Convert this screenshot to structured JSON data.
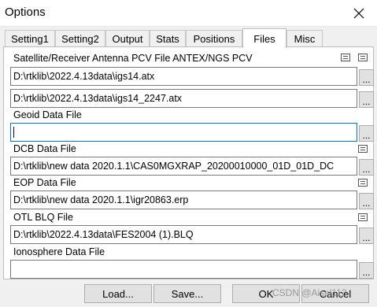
{
  "window": {
    "title": "Options"
  },
  "tabs": [
    "Setting1",
    "Setting2",
    "Output",
    "Stats",
    "Positions",
    "Files",
    "Misc"
  ],
  "active_tab": "Files",
  "files": {
    "antenna_label": "Satellite/Receiver Antenna PCV File ANTEX/NGS PCV",
    "antenna_sat": "D:\\rtklib\\2022.4.13data\\igs14.atx",
    "antenna_rcv": "D:\\rtklib\\2022.4.13data\\igs14_2247.atx",
    "geoid_label": "Geoid Data File",
    "geoid_value": "",
    "dcb_label": "DCB Data File",
    "dcb_value": "D:\\rtklib\\new data 2020.1.1\\CAS0MGXRAP_20200010000_01D_01D_DC",
    "eop_label": "EOP Data File",
    "eop_value": "D:\\rtklib\\new data 2020.1.1\\igr20863.erp",
    "otl_label": "OTL BLQ File",
    "otl_value": "D:\\rtklib\\2022.4.13data\\FES2004 (1).BLQ",
    "iono_label": "Ionosphere Data File",
    "iono_value": ""
  },
  "browse_label": "...",
  "buttons": {
    "load": "Load...",
    "save": "Save...",
    "ok": "OK",
    "cancel": "Cancel"
  },
  "watermark": "CSDN @Aisel113"
}
